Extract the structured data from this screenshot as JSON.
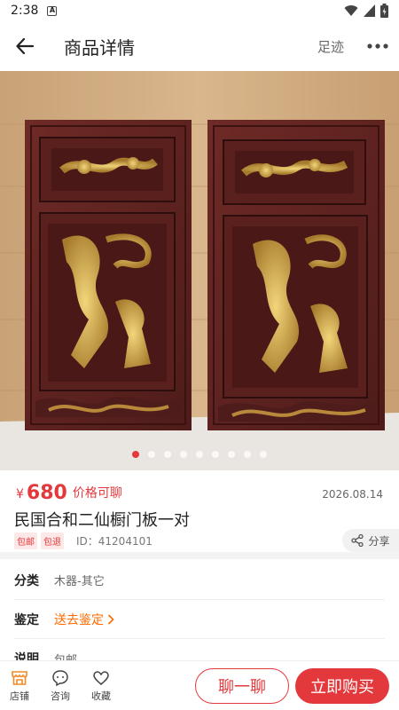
{
  "status": {
    "time": "2:38"
  },
  "header": {
    "title": "商品详情",
    "footprint": "足迹"
  },
  "product": {
    "currency": "¥",
    "price": "680",
    "negotiable": "价格可聊",
    "date": "2026.08.14",
    "title": "民国合和二仙橱门板一对",
    "tags": [
      "包邮",
      "包退"
    ],
    "id_text": "ID：41204101",
    "share": "分享",
    "image_count": 9,
    "active_image": 1
  },
  "info": [
    {
      "key": "分类",
      "value": "木器-其它"
    },
    {
      "key": "鉴定",
      "value": "送去鉴定"
    },
    {
      "key": "说明",
      "value": "包邮"
    }
  ],
  "bottom_bar": {
    "shop": "店铺",
    "consult": "咨询",
    "favorite": "收藏",
    "chat": "聊一聊",
    "buy": "立即购买"
  },
  "colors": {
    "accent": "#e4393c",
    "link": "#ff6a00"
  }
}
